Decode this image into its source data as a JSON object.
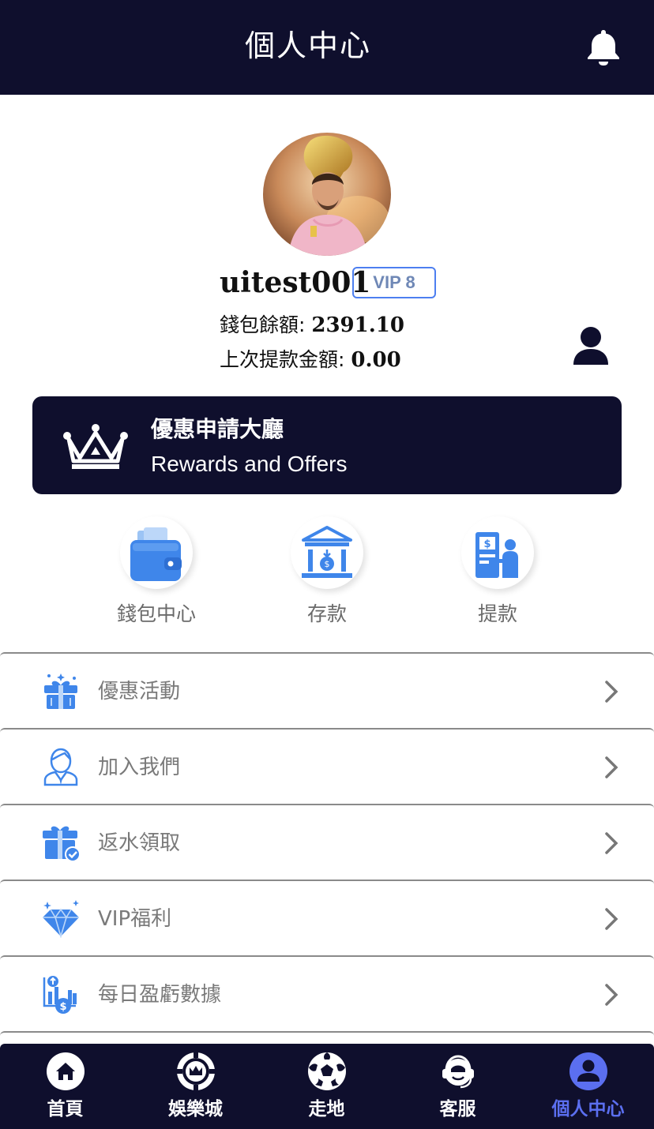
{
  "header": {
    "title": "個人中心"
  },
  "profile": {
    "username": "uitest001",
    "vip": "VIP 8",
    "wallet_label": "錢包餘額: ",
    "wallet_value": "2391.10",
    "last_withdraw_label": "上次提款金額: ",
    "last_withdraw_value": "0.00"
  },
  "rewards": {
    "title": "優惠申請大廳",
    "subtitle": "Rewards and Offers"
  },
  "quick_actions": [
    {
      "label": "錢包中心",
      "icon": "wallet-icon"
    },
    {
      "label": "存款",
      "icon": "bank-deposit-icon"
    },
    {
      "label": "提款",
      "icon": "atm-withdraw-icon"
    }
  ],
  "menu": [
    {
      "label": "優惠活動",
      "icon": "gift-icon"
    },
    {
      "label": "加入我們",
      "icon": "agent-person-icon"
    },
    {
      "label": "返水領取",
      "icon": "gift-check-icon"
    },
    {
      "label": "VIP福利",
      "icon": "diamond-icon"
    },
    {
      "label": "每日盈虧數據",
      "icon": "chart-dollar-icon"
    }
  ],
  "nav": [
    {
      "label": "首頁",
      "icon": "home-icon"
    },
    {
      "label": "娛樂城",
      "icon": "casino-chip-icon"
    },
    {
      "label": "走地",
      "icon": "soccer-ball-icon"
    },
    {
      "label": "客服",
      "icon": "headset-icon"
    },
    {
      "label": "個人中心",
      "icon": "user-circle-icon",
      "active": true
    }
  ],
  "colors": {
    "header_bg": "#0f0f2d",
    "accent": "#4a7fe8",
    "nav_active": "#5b6ff0"
  }
}
